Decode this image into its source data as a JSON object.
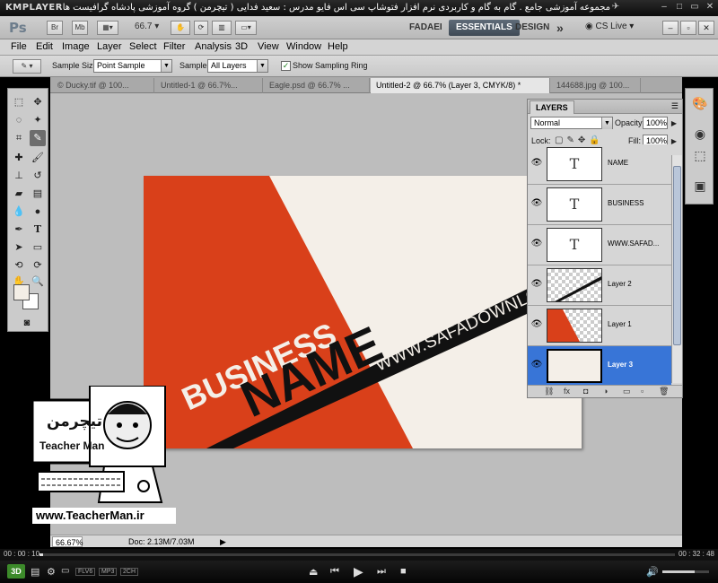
{
  "player": {
    "name": "KMPLAYER",
    "caption": "مجموعه آموزشی جامع . گام به گام و کاربردی نرم افزار فتوشاپ سی اس فایو  مدرس : سعید فدایی ( تیچرمن ) گروه آموزشی پادشاه گرافیست ها",
    "time_current": "00 : 00 : 10",
    "time_total": "00 : 32 : 48",
    "progress": 0.005,
    "volume": 0.7,
    "codec_badges": [
      "FLV6",
      "MP3",
      "2CH"
    ]
  },
  "appbar": {
    "logo": "Ps",
    "bridge_label": "Br",
    "minibridge_label": "Mb",
    "zoom": "66.7",
    "workspaces": [
      "FADAEI",
      "ESSENTIALS",
      "DESIGN"
    ],
    "active_workspace": "ESSENTIALS",
    "more": "»",
    "cs_live": "CS Live"
  },
  "menu": [
    "File",
    "Edit",
    "Image",
    "Layer",
    "Select",
    "Filter",
    "Analysis",
    "3D",
    "View",
    "Window",
    "Help"
  ],
  "options": {
    "sample_size_label": "Sample Size:",
    "sample_size_value": "Point Sample",
    "sample_label": "Sample:",
    "sample_value": "All Layers",
    "show_ring_label": "Show Sampling Ring",
    "show_ring_checked": true
  },
  "doc_tabs": [
    "© Ducky.tif @ 100...",
    "Untitled-1 @ 66.7%...",
    "Eagle.psd @ 66.7% ...",
    "Untitled-2 @ 66.7% (Layer 3, CMYK/8) *",
    "144688.jpg @ 100..."
  ],
  "active_tab": 3,
  "canvas": {
    "word1": "BUSINESS",
    "word2": "NAME",
    "stripe_text": "WWW.SAFADOWNLOAD",
    "orange": "#d9401a",
    "cream": "#f4efe8",
    "black": "#111111"
  },
  "status": {
    "zoom": "66.67%",
    "doc": "Doc: 2.13M/7.03M"
  },
  "layers_panel": {
    "tab": "LAYERS",
    "blend_mode": "Normal",
    "opacity_label": "Opacity:",
    "opacity": "100%",
    "lock_label": "Lock:",
    "fill_label": "Fill:",
    "fill": "100%",
    "layers": [
      {
        "name": "NAME",
        "kind": "text"
      },
      {
        "name": "BUSINESS",
        "kind": "text"
      },
      {
        "name": "WWW.SAFAD...",
        "kind": "text"
      },
      {
        "name": "Layer 2",
        "kind": "stripe"
      },
      {
        "name": "Layer 1",
        "kind": "orange"
      },
      {
        "name": "Layer 3",
        "kind": "fill",
        "active": true
      }
    ]
  },
  "watermark": {
    "url": "www.TeacherMan.ir",
    "brand": "Teacher Man",
    "brand_fa": "تیچرمن"
  }
}
